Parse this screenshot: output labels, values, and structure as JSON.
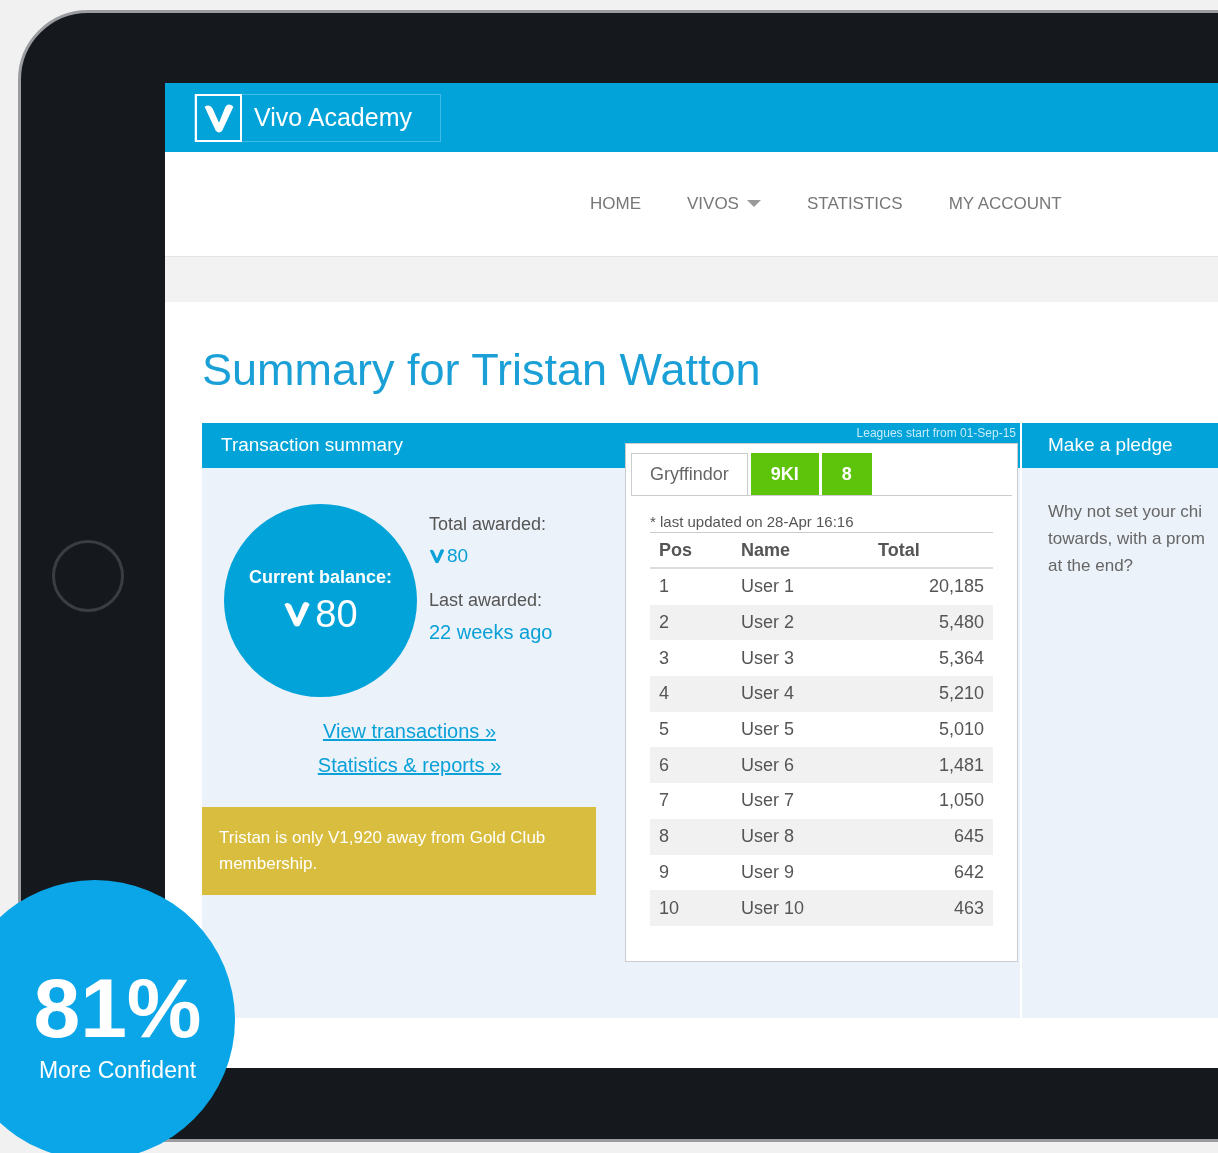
{
  "header": {
    "brand": "Vivo Academy"
  },
  "nav": [
    {
      "label": "HOME",
      "dropdown": false
    },
    {
      "label": "VIVOS",
      "dropdown": true
    },
    {
      "label": "STATISTICS",
      "dropdown": false
    },
    {
      "label": "MY ACCOUNT",
      "dropdown": false
    }
  ],
  "page_title": "Summary for Tristan Watton",
  "transaction_summary": {
    "title": "Transaction summary",
    "balance_label": "Current balance:",
    "balance": "80",
    "total_label": "Total awarded:",
    "total": "80",
    "last_label": "Last awarded:",
    "last": "22 weeks ago",
    "links": [
      "View transactions »",
      "Statistics & reports »"
    ],
    "notice": "Tristan is only V1,920 away from Gold Club membership."
  },
  "league": {
    "note": "Leagues start from 01-Sep-15",
    "tabs": [
      {
        "label": "Gryffindor",
        "selected": true
      },
      {
        "label": "9KI",
        "selected": false
      },
      {
        "label": "8",
        "selected": false
      }
    ],
    "updated": "* last updated on 28-Apr 16:16",
    "columns": [
      "Pos",
      "Name",
      "Total"
    ],
    "rows": [
      [
        "1",
        "User 1",
        "20,185"
      ],
      [
        "2",
        "User 2",
        "5,480"
      ],
      [
        "3",
        "User 3",
        "5,364"
      ],
      [
        "4",
        "User 4",
        "5,210"
      ],
      [
        "5",
        "User 5",
        "5,010"
      ],
      [
        "6",
        "User 6",
        "1,481"
      ],
      [
        "7",
        "User 7",
        "1,050"
      ],
      [
        "8",
        "User 8",
        "645"
      ],
      [
        "9",
        "User 9",
        "642"
      ],
      [
        "10",
        "User 10",
        "463"
      ]
    ]
  },
  "pledge": {
    "title": "Make a pledge",
    "lines": [
      "Why not set your chi",
      "towards, with a prom",
      "at the end?"
    ]
  },
  "badge": {
    "value": "81%",
    "label": "More Confident"
  }
}
